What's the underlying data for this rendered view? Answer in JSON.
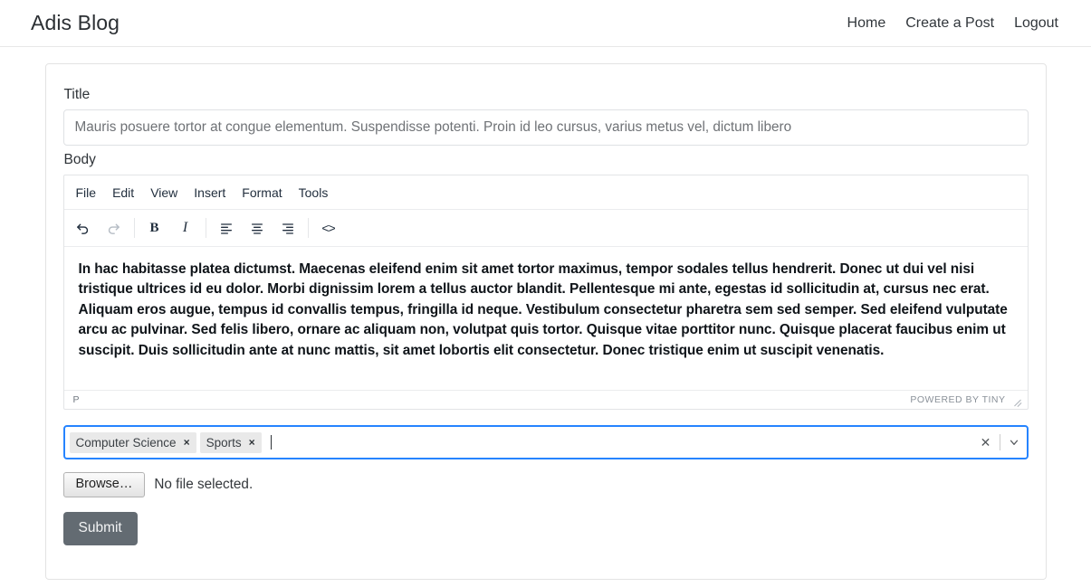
{
  "navbar": {
    "brand": "Adis Blog",
    "links": [
      {
        "label": "Home",
        "name": "nav-link-home"
      },
      {
        "label": "Create a Post",
        "name": "nav-link-create-a-post"
      },
      {
        "label": "Logout",
        "name": "nav-link-logout"
      }
    ]
  },
  "form": {
    "title_label": "Title",
    "title_value": "Mauris posuere tortor at congue elementum. Suspendisse potenti. Proin id leo cursus, varius metus vel, dictum libero",
    "title_placeholder": "Title",
    "body_label": "Body"
  },
  "editor": {
    "menus": [
      "File",
      "Edit",
      "View",
      "Insert",
      "Format",
      "Tools"
    ],
    "toolbar": [
      {
        "name": "undo-icon",
        "glyph": "↶",
        "state": "enabled"
      },
      {
        "name": "redo-icon",
        "glyph": "↷",
        "state": "disabled"
      },
      {
        "name": "bold-icon",
        "glyph": "B",
        "state": "enabled"
      },
      {
        "name": "italic-icon",
        "glyph": "I",
        "state": "enabled"
      },
      {
        "name": "align-left-icon",
        "glyph": "align-left",
        "state": "enabled"
      },
      {
        "name": "align-center-icon",
        "glyph": "align-center",
        "state": "enabled"
      },
      {
        "name": "align-right-icon",
        "glyph": "align-right",
        "state": "enabled"
      },
      {
        "name": "source-code-icon",
        "glyph": "<>",
        "state": "enabled"
      }
    ],
    "content": "In hac habitasse platea dictumst. Maecenas eleifend enim sit amet tortor maximus, tempor sodales tellus hendrerit. Donec ut dui vel nisi tristique ultrices id eu dolor. Morbi dignissim lorem a tellus auctor blandit. Pellentesque mi ante, egestas id sollicitudin at, cursus nec erat. Aliquam eros augue, tempus id convallis tempus, fringilla id neque. Vestibulum consectetur pharetra sem sed semper. Sed eleifend vulputate arcu ac pulvinar. Sed felis libero, ornare ac aliquam non, volutpat quis tortor. Quisque vitae porttitor nunc. Quisque placerat faucibus enim ut suscipit. Duis sollicitudin ante at nunc mattis, sit amet lobortis elit consectetur. Donec tristique enim ut suscipit venenatis.",
    "status_path": "P",
    "status_brand": "POWERED BY TINY"
  },
  "tags": {
    "selected": [
      {
        "label": "Computer Science",
        "remove": "×"
      },
      {
        "label": "Sports",
        "remove": "×"
      }
    ],
    "clear_icon": "✕",
    "dropdown_icon": "⌄",
    "focus_color": "#2684ff"
  },
  "file": {
    "browse_label": "Browse…",
    "status": "No file selected."
  },
  "submit": {
    "label": "Submit",
    "color": "#636b72"
  }
}
